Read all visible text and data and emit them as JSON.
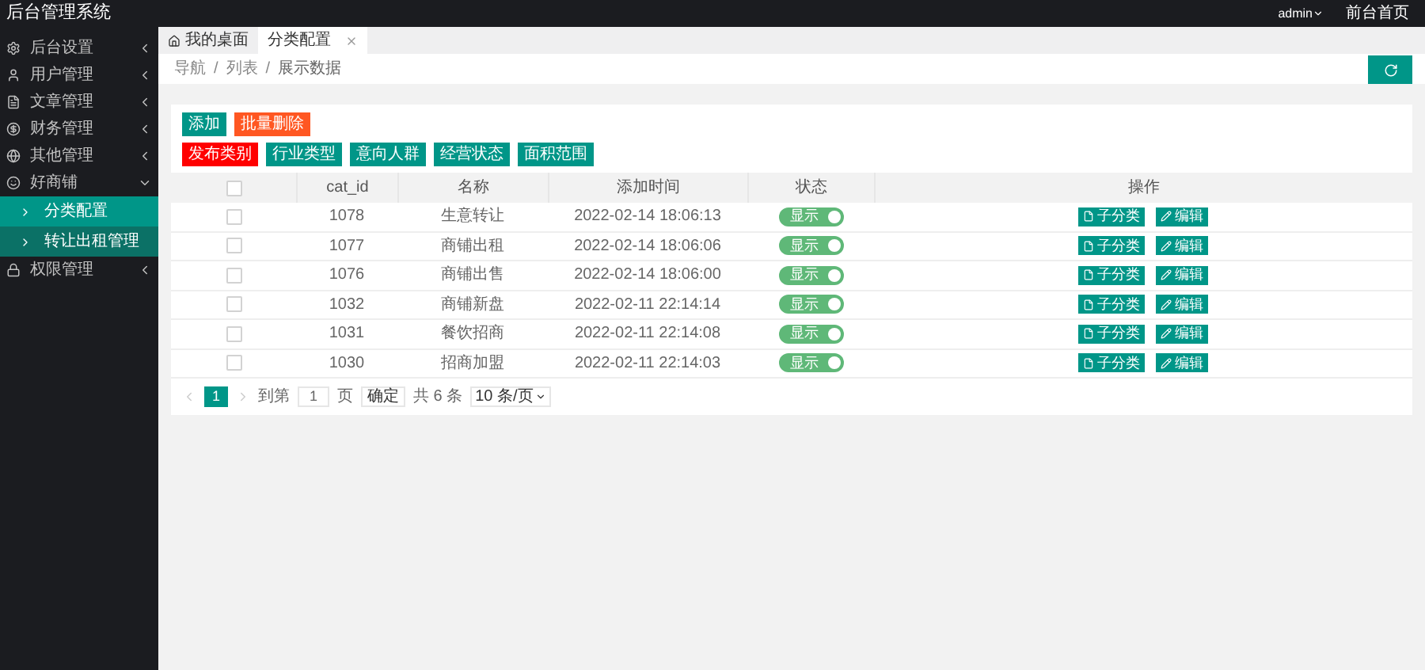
{
  "header": {
    "title": "后台管理系统",
    "user": "admin",
    "home_link": "前台首页"
  },
  "sidebar": {
    "items": [
      {
        "label": "后台设置",
        "expanded": false
      },
      {
        "label": "用户管理",
        "expanded": false
      },
      {
        "label": "文章管理",
        "expanded": false
      },
      {
        "label": "财务管理",
        "expanded": false
      },
      {
        "label": "其他管理",
        "expanded": false
      },
      {
        "label": "好商铺",
        "expanded": true,
        "children": [
          {
            "label": "分类配置",
            "selected": true
          },
          {
            "label": "转让出租管理",
            "selected": false
          }
        ]
      },
      {
        "label": "权限管理",
        "expanded": false
      }
    ]
  },
  "tabs": [
    {
      "label": "我的桌面",
      "kind": "home",
      "selected": false
    },
    {
      "label": "分类配置",
      "kind": "closable",
      "selected": true
    }
  ],
  "breadcrumb": {
    "items": [
      "导航",
      "列表",
      "展示数据"
    ],
    "separator": "/"
  },
  "toolbar": [
    [
      {
        "label": "添加",
        "color": "#009688"
      },
      {
        "label": "批量删除",
        "color": "#ff5722"
      }
    ],
    [
      {
        "label": "发布类别",
        "color": "#ff0000"
      },
      {
        "label": "行业类型",
        "color": "#009688"
      },
      {
        "label": "意向人群",
        "color": "#009688"
      },
      {
        "label": "经营状态",
        "color": "#009688"
      },
      {
        "label": "面积范围",
        "color": "#009688"
      }
    ]
  ],
  "table": {
    "columns": [
      "cat_id",
      "名称",
      "添加时间",
      "状态",
      "操作"
    ],
    "header_checked": false,
    "rows": [
      {
        "checked": false,
        "id": "1078",
        "name": "生意转让",
        "time": "2022-02-14 18:06:13",
        "status": "显示",
        "on": true,
        "actions": [
          "子分类",
          "编辑"
        ]
      },
      {
        "checked": false,
        "id": "1077",
        "name": "商铺出租",
        "time": "2022-02-14 18:06:06",
        "status": "显示",
        "on": true,
        "actions": [
          "子分类",
          "编辑"
        ]
      },
      {
        "checked": false,
        "id": "1076",
        "name": "商铺出售",
        "time": "2022-02-14 18:06:00",
        "status": "显示",
        "on": true,
        "actions": [
          "子分类",
          "编辑"
        ]
      },
      {
        "checked": false,
        "id": "1032",
        "name": "商铺新盘",
        "time": "2022-02-11 22:14:14",
        "status": "显示",
        "on": true,
        "actions": [
          "子分类",
          "编辑"
        ]
      },
      {
        "checked": false,
        "id": "1031",
        "name": "餐饮招商",
        "time": "2022-02-11 22:14:08",
        "status": "显示",
        "on": true,
        "actions": [
          "子分类",
          "编辑"
        ]
      },
      {
        "checked": false,
        "id": "1030",
        "name": "招商加盟",
        "time": "2022-02-11 22:14:03",
        "status": "显示",
        "on": true,
        "actions": [
          "子分类",
          "编辑"
        ]
      }
    ]
  },
  "pagination": {
    "pages": [
      {
        "label": "1",
        "selected": true
      }
    ],
    "goto_label": "到第",
    "goto_value": "1",
    "page_unit": "页",
    "confirm": "确定",
    "total": "共 6 条",
    "page_size": "10 条/页"
  }
}
